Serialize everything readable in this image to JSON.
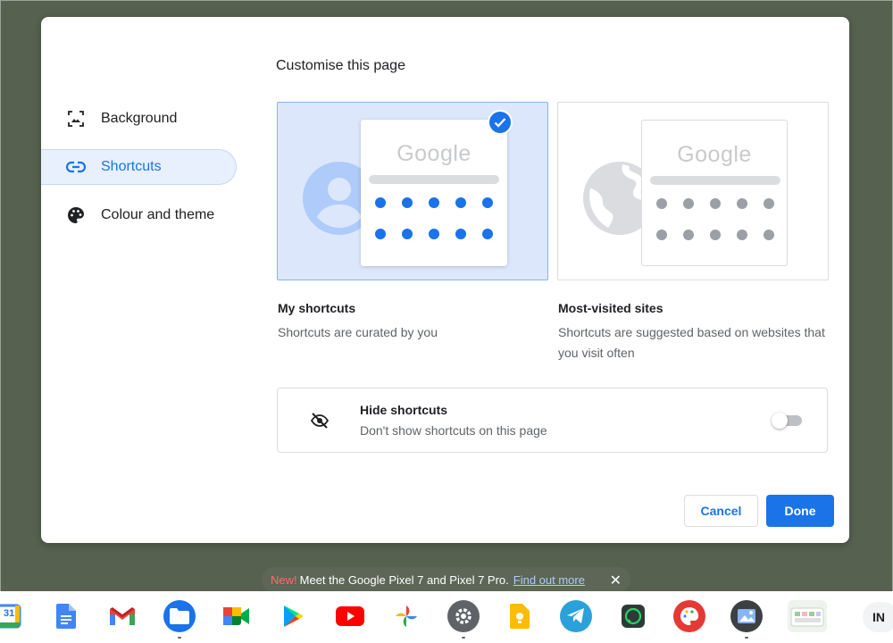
{
  "dialog": {
    "title": "Customise this page",
    "nav": [
      {
        "label": "Background",
        "icon": "image-icon"
      },
      {
        "label": "Shortcuts",
        "icon": "link-icon"
      },
      {
        "label": "Colour and theme",
        "icon": "palette-icon"
      }
    ],
    "active_nav": "Shortcuts",
    "options": [
      {
        "preview_logo": "Google",
        "title": "My shortcuts",
        "description": "Shortcuts are curated by you",
        "selected": true
      },
      {
        "preview_logo": "Google",
        "title": "Most-visited sites",
        "description": "Shortcuts are suggested based on websites that you visit often",
        "selected": false
      }
    ],
    "hide_shortcuts": {
      "title": "Hide shortcuts",
      "description": "Don't show shortcuts on this page",
      "enabled": false
    },
    "buttons": {
      "cancel": "Cancel",
      "done": "Done"
    }
  },
  "promo": {
    "new_label": "New!",
    "text": "Meet the Google Pixel 7 and Pixel 7 Pro.",
    "link": "Find out more",
    "close": "✕"
  },
  "shelf": {
    "apps": [
      "calendar",
      "docs",
      "gmail",
      "files",
      "meet",
      "play-store",
      "youtube",
      "photos",
      "settings",
      "keep",
      "telegram",
      "whatsapp",
      "paint",
      "gallery",
      "other"
    ],
    "calendar_day": "31",
    "ime": "IN"
  },
  "colors": {
    "accent": "#1a73e8",
    "selected_card_bg": "#dde7fb",
    "desktop_bg": "#56614f"
  }
}
